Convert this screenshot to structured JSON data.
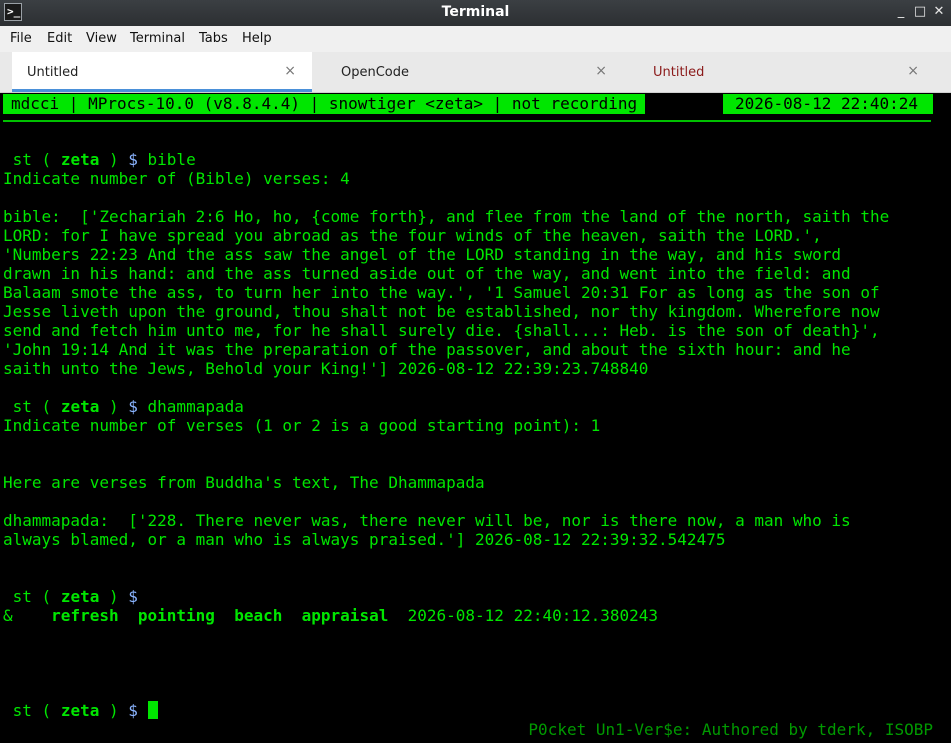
{
  "window": {
    "title": "Terminal",
    "app_icon_glyph": ">_",
    "controls": {
      "minimize": "_",
      "maximize": "□",
      "close": "✕"
    }
  },
  "menubar": {
    "items": [
      {
        "label": "File"
      },
      {
        "label": "Edit"
      },
      {
        "label": "View"
      },
      {
        "label": "Terminal"
      },
      {
        "label": "Tabs"
      },
      {
        "label": "Help"
      }
    ]
  },
  "tabs": [
    {
      "label": "Untitled",
      "close": "×",
      "active": true
    },
    {
      "label": "OpenCode",
      "close": "×",
      "active": false
    },
    {
      "label": "Untitled",
      "close": "×",
      "active": false
    }
  ],
  "terminal": {
    "status_left": "mdcci | MProcs-10.0 (v8.8.4.4) | snowtiger <zeta> | not recording",
    "status_right": "2026-08-12 22:40:24",
    "prompt": {
      "open": "st ( ",
      "host": "zeta",
      "close": " ) ",
      "dollar": "$"
    },
    "commands": [
      "bible",
      "dhammapada"
    ],
    "lines": {
      "bible_q": "Indicate number of (Bible) verses: 4",
      "bible_1": "bible:  ['Zechariah 2:6 Ho, ho, {come forth}, and flee from the land of the north, saith the",
      "bible_2": "LORD: for I have spread you abroad as the four winds of the heaven, saith the LORD.',",
      "bible_3": "'Numbers 22:23 And the ass saw the angel of the LORD standing in the way, and his sword",
      "bible_4": "drawn in his hand: and the ass turned aside out of the way, and went into the field: and",
      "bible_5": "Balaam smote the ass, to turn her into the way.', '1 Samuel 20:31 For as long as the son of",
      "bible_6": "Jesse liveth upon the ground, thou shalt not be established, nor thy kingdom. Wherefore now",
      "bible_7": "send and fetch him unto me, for he shall surely die. {shall...: Heb. is the son of death}',",
      "bible_8": "'John 19:14 And it was the preparation of the passover, and about the sixth hour: and he",
      "bible_9": "saith unto the Jews, Behold your King!'] 2026-08-12 22:39:23.748840",
      "dham_q": "Indicate number of verses (1 or 2 is a good starting point): 1",
      "dham_intro": "Here are verses from Buddha's text, The Dhammapada",
      "dham_1": "dhammapada:  ['228. There never was, there never will be, nor is there now, a man who is",
      "dham_2": "always blamed, or a man who is always praised.'] 2026-08-12 22:39:32.542475",
      "words_amp": "&",
      "words": [
        "refresh",
        "pointing",
        "beach",
        "appraisal"
      ],
      "words_time": "2026-08-12 22:40:12.380243"
    },
    "footer": "P0cket Un1-Ver$e: Authored by tderk, ISOBP",
    "colors": {
      "fg": "#00e600",
      "bg": "#000000",
      "prompt_dollar": "#8ab4ff"
    }
  }
}
